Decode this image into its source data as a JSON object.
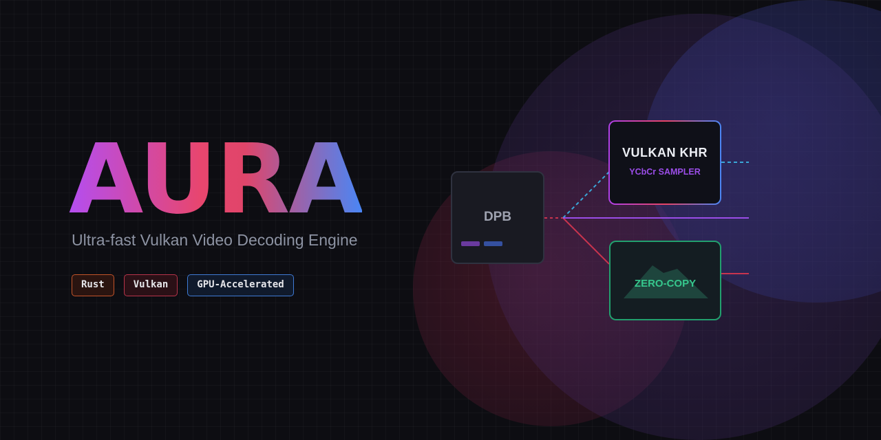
{
  "brand": {
    "title": "AURA",
    "subtitle": "Ultra-fast Vulkan Video Decoding Engine"
  },
  "badges": [
    {
      "label": "Rust",
      "color": "#c4552a"
    },
    {
      "label": "Vulkan",
      "color": "#b8344a"
    },
    {
      "label": "GPU-Accelerated",
      "color": "#3f7bd6"
    }
  ],
  "diagram": {
    "dpb_node": {
      "label": "DPB"
    },
    "vulkan_node": {
      "title": "VULKAN KHR",
      "subtitle": "YCbCr SAMPLER"
    },
    "zero_copy_node": {
      "label": "ZERO-COPY"
    }
  },
  "colors": {
    "gradient_start": "#b44ef0",
    "gradient_mid": "#e8466e",
    "gradient_end": "#4a86f5",
    "zero_copy_green": "#22a06e",
    "connector_cyan": "#3aa7d8",
    "connector_purple": "#9b4de8",
    "connector_red": "#c8344e"
  }
}
